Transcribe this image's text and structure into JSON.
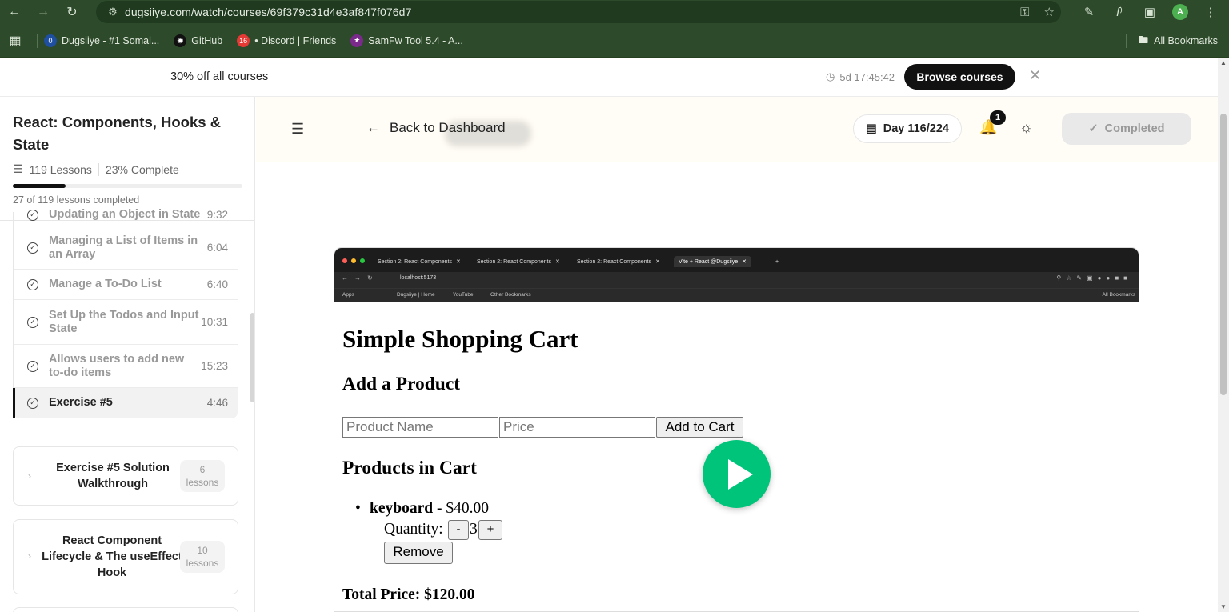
{
  "browser": {
    "url": "dugsiiye.com/watch/courses/69f379c31d4e3af847f076d7",
    "bookmarks": [
      {
        "label": "Dugsiiye - #1 Somal...",
        "color": "#1e4fa0",
        "glyph": "0"
      },
      {
        "label": "GitHub",
        "color": "#222222",
        "glyph": ""
      },
      {
        "label": "• Discord | Friends",
        "color": "#e53935",
        "glyph": "16"
      },
      {
        "label": "SamFw Tool 5.4 - A...",
        "color": "#7a2a8a",
        "glyph": ""
      }
    ],
    "all_bookmarks": "All Bookmarks",
    "profile_initial": "A"
  },
  "promo": {
    "text": "30% off all courses",
    "timer": "5d 17:45:42",
    "button": "Browse courses"
  },
  "sidebar": {
    "course_title": "React: Components, Hooks & State",
    "lessons_count": "119 Lessons",
    "percent_complete": "23% Complete",
    "progress_fraction": 0.23,
    "completed_line": "27 of 119 lessons completed",
    "lessons": [
      {
        "title": "Updating an Object in State",
        "duration": "9:32"
      },
      {
        "title": "Managing a List of Items in an Array",
        "duration": "6:04"
      },
      {
        "title": "Manage a To-Do List",
        "duration": "6:40"
      },
      {
        "title": "Set Up the Todos and Input State",
        "duration": "10:31"
      },
      {
        "title": "Allows users to add new to-do items",
        "duration": "15:23"
      },
      {
        "title": "Exercise #5",
        "duration": "4:46"
      }
    ],
    "sections": [
      {
        "title": "Exercise #5 Solution Walkthrough",
        "count": "6",
        "unit": "lessons"
      },
      {
        "title": "React Component Lifecycle & The useEffect Hook",
        "count": "10",
        "unit": "lessons"
      }
    ]
  },
  "header": {
    "back_label": "Back to Dashboard",
    "day": "Day 116/224",
    "notifications": "1",
    "completed_label": "Completed"
  },
  "video": {
    "tabs": [
      "Section 2: React Components",
      "Section 2: React Components",
      "Section 2: React Components",
      "Vite + React @Dugsiiye"
    ],
    "address": "localhost:5173",
    "bookmarks": [
      "Apps",
      "Dugsiiye | Home",
      "YouTube",
      "Other Bookmarks",
      "All Bookmarks"
    ],
    "app": {
      "title": "Simple Shopping Cart",
      "add_heading": "Add a Product",
      "name_placeholder": "Product Name",
      "price_placeholder": "Price",
      "add_button": "Add to Cart",
      "cart_heading": "Products in Cart",
      "item_name": "keyboard",
      "item_price": " - $40.00",
      "quantity_label": "Quantity:",
      "minus": "-",
      "quantity": "3",
      "plus": "+",
      "remove": "Remove",
      "total": "Total Price: $120.00"
    }
  }
}
